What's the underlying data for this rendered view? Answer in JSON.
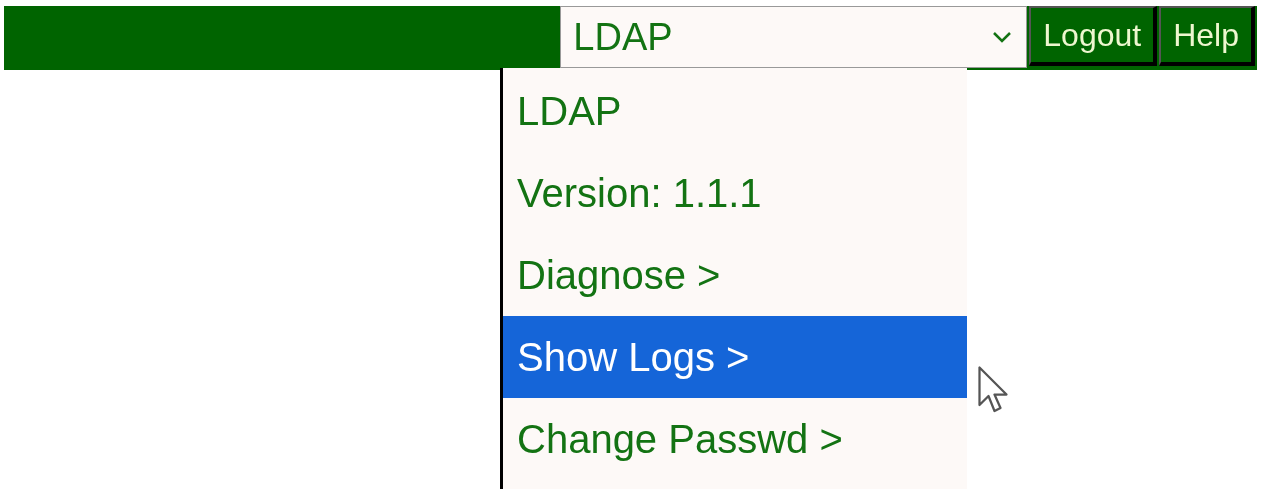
{
  "header": {
    "select_value": "LDAP",
    "buttons": [
      "Logout",
      "Help"
    ]
  },
  "dropdown": {
    "expanded": true,
    "items": [
      {
        "label": "LDAP",
        "selected": false
      },
      {
        "label": "Version: 1.1.1",
        "selected": false
      },
      {
        "label": "Diagnose >",
        "selected": false
      },
      {
        "label": "Show Logs >",
        "selected": true
      },
      {
        "label": "Change Passwd >",
        "selected": false
      }
    ]
  }
}
